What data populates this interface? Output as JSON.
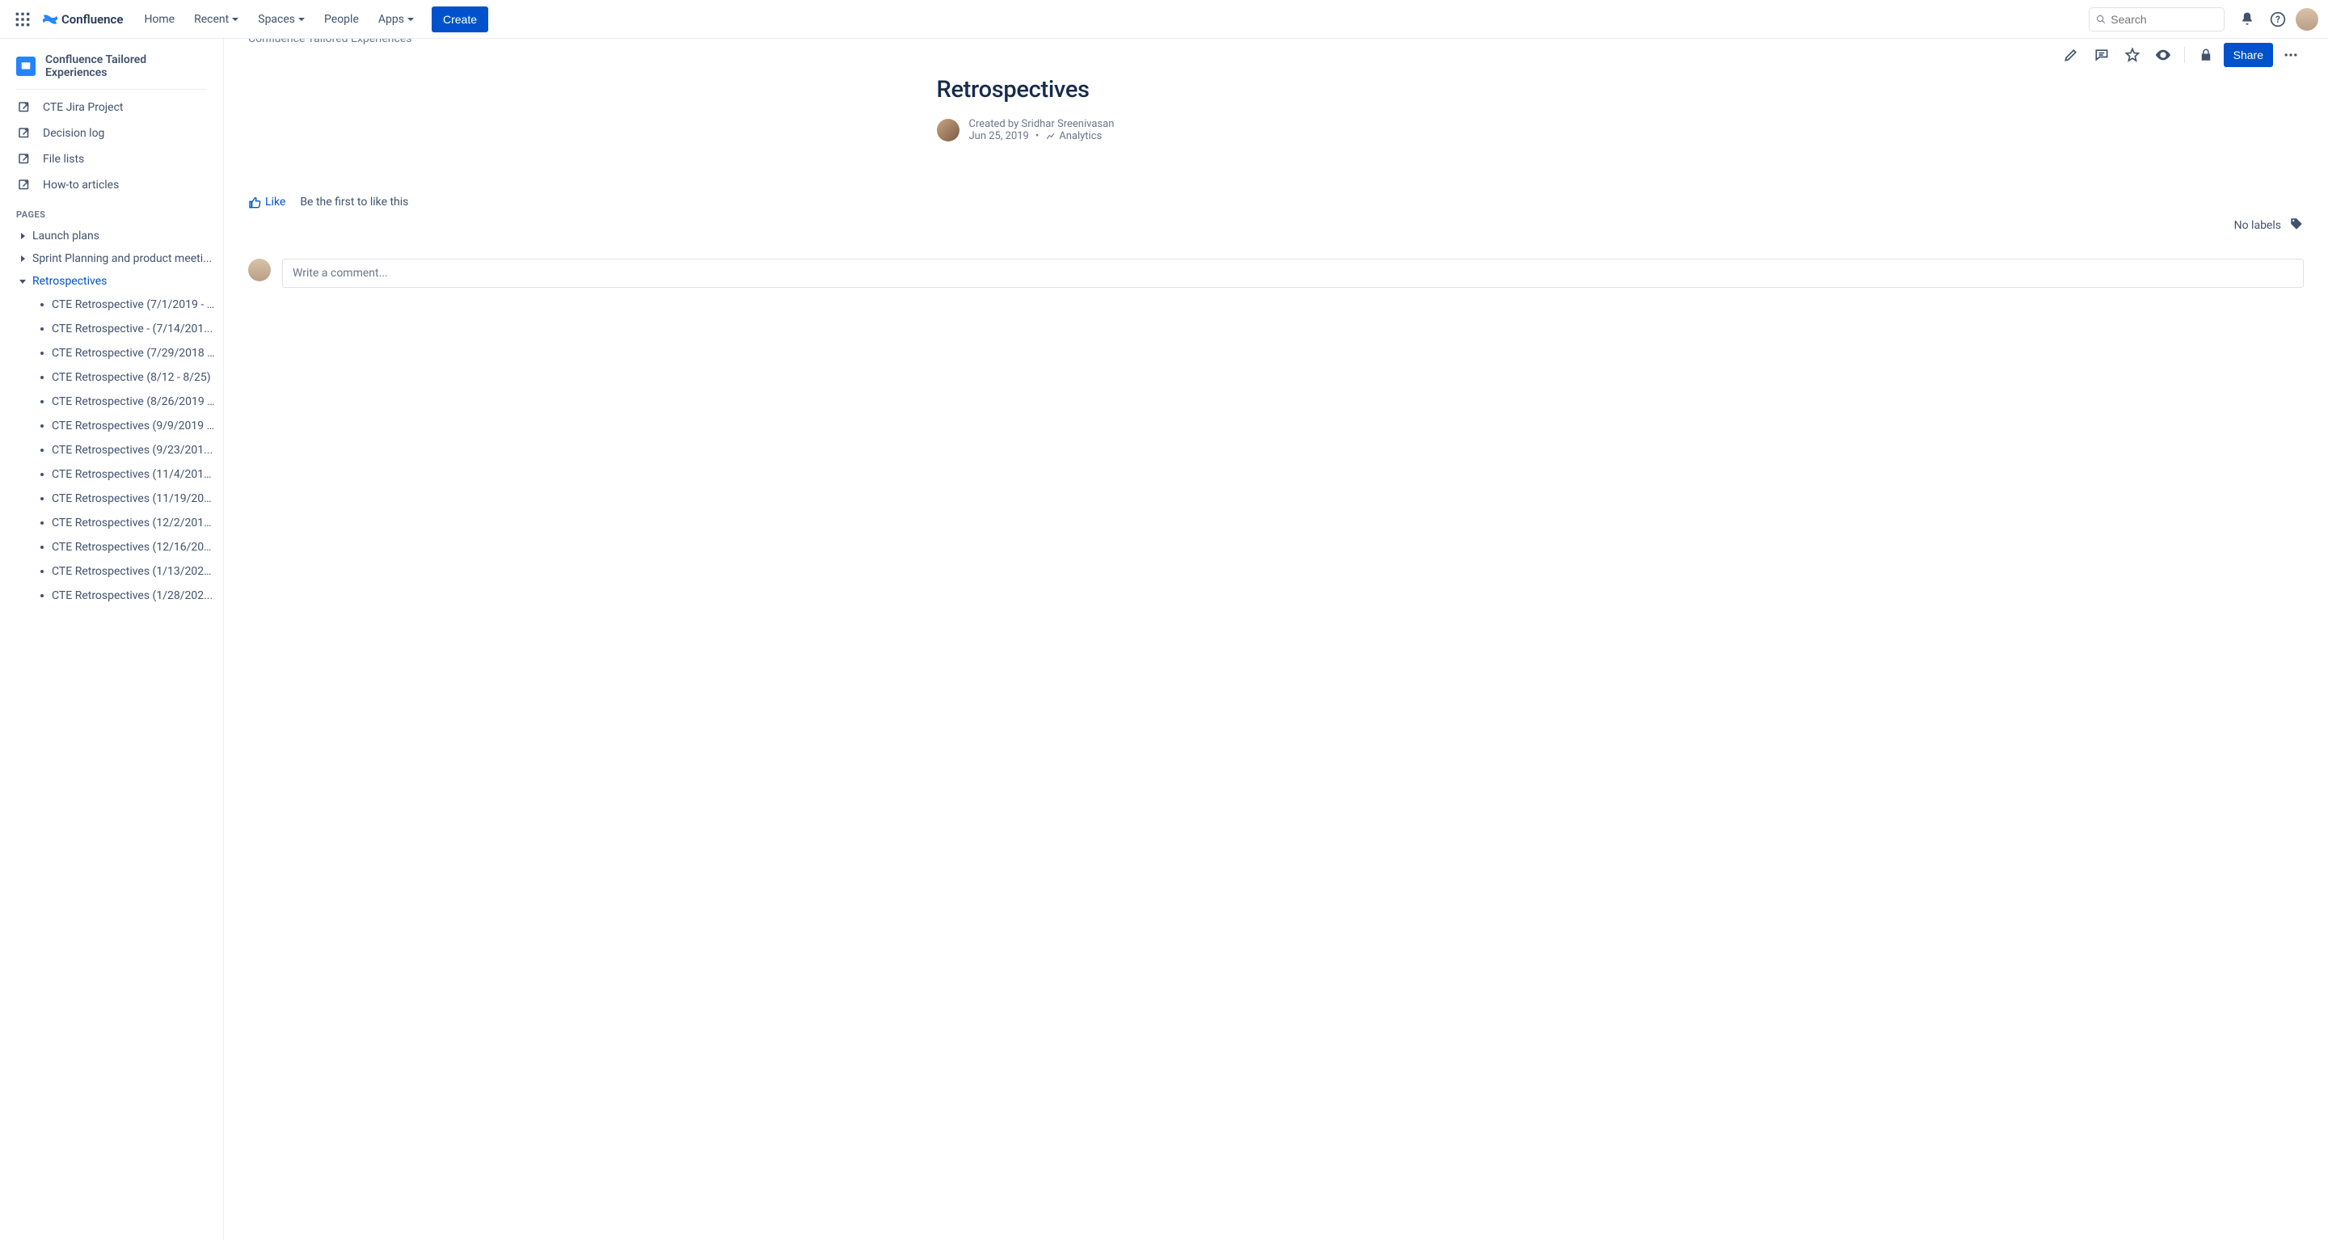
{
  "app": {
    "product": "Confluence"
  },
  "header": {
    "nav": {
      "home": "Home",
      "recent": "Recent",
      "spaces": "Spaces",
      "people": "People",
      "apps": "Apps"
    },
    "create_label": "Create",
    "search_placeholder": "Search"
  },
  "sidebar": {
    "space_name": "Confluence Tailored Experiences",
    "shortcuts": [
      {
        "label": "CTE Jira Project"
      },
      {
        "label": "Decision log"
      },
      {
        "label": "File lists"
      },
      {
        "label": "How-to articles"
      }
    ],
    "pages_section_label": "PAGES",
    "tree": {
      "launch_plans": "Launch plans",
      "sprint_planning": "Sprint Planning and product meeti...",
      "retrospectives": "Retrospectives"
    },
    "retro_children": [
      "CTE Retrospective (7/1/2019 - ...",
      "CTE Retrospective - (7/14/201...",
      "CTE Retrospective (7/29/2018 ...",
      "CTE Retrospective (8/12 - 8/25)",
      "CTE Retrospective (8/26/2019 ...",
      "CTE Retrospectives (9/9/2019 ...",
      "CTE Retrospectives (9/23/201...",
      "CTE Retrospectives (11/4/2019...",
      "CTE Retrospectives (11/19/201...",
      "CTE Retrospectives (12/2/2019...",
      "CTE Retrospectives (12/16/201...",
      "CTE Retrospectives (1/13/2020...",
      "CTE Retrospectives (1/28/202..."
    ]
  },
  "toolbar": {
    "share_label": "Share"
  },
  "breadcrumb": {
    "space": "Confluence Tailored Experiences"
  },
  "page": {
    "title": "Retrospectives",
    "created_by_prefix": "Created by ",
    "author": "Sridhar Sreenivasan",
    "date": "Jun 25, 2019",
    "analytics_label": "Analytics"
  },
  "like": {
    "like_label": "Like",
    "prompt": "Be the first to like this"
  },
  "labels": {
    "no_labels": "No labels"
  },
  "comment": {
    "placeholder": "Write a comment..."
  }
}
